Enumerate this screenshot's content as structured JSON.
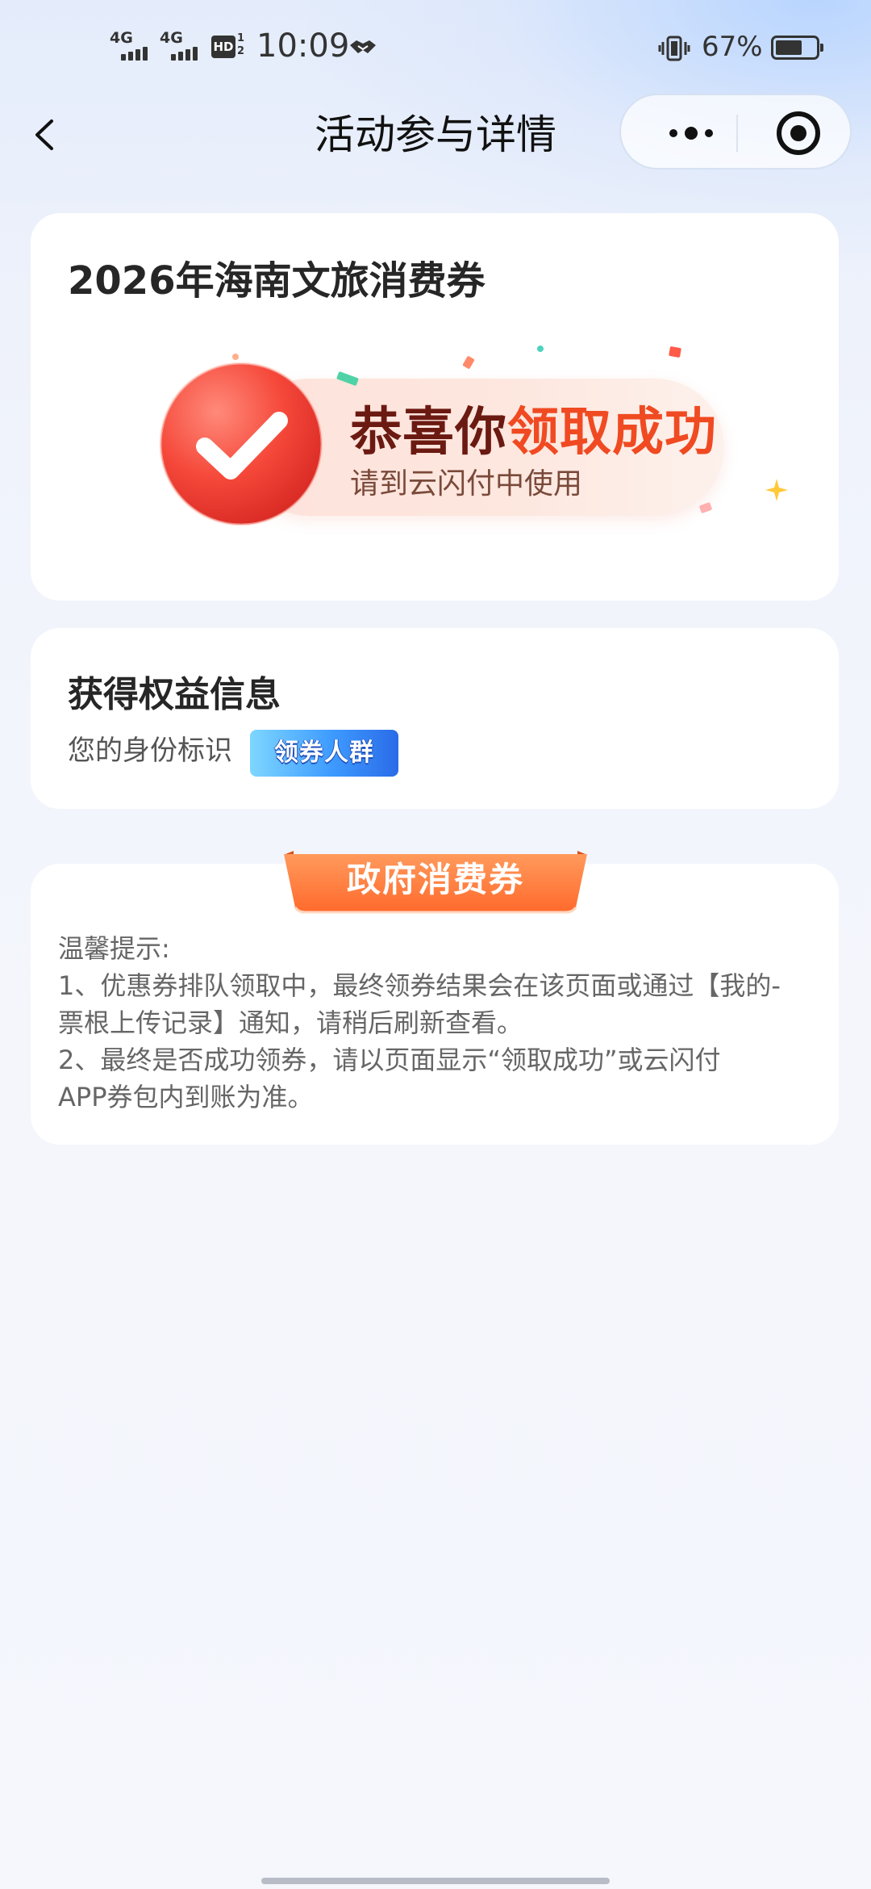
{
  "status_bar": {
    "network_1": "4G",
    "network_2": "4G",
    "hd_label": "HD",
    "hd_sub": "1\n2",
    "time": "10:09",
    "battery_percent": "67%",
    "battery_level": 0.67
  },
  "nav": {
    "title": "活动参与详情"
  },
  "activity": {
    "title": "2026年海南文旅消费券",
    "banner_line1_dark": "恭喜你",
    "banner_line1_highlight": "领取成功",
    "banner_line2": "请到云闪付中使用"
  },
  "rights": {
    "title": "获得权益信息",
    "identity_label": "您的身份标识",
    "identity_badge": "领券人群"
  },
  "gov_coupon": {
    "ribbon": "政府消费券",
    "tips": [
      "温馨提示:",
      "1、优惠券排队领取中，最终领券结果会在该页面或通过【我的-",
      "票根上传记录】通知，请稍后刷新查看。",
      "2、最终是否成功领券，请以页面显示“领取成功”或云闪付",
      "APP券包内到账为准。"
    ]
  },
  "colors": {
    "accent_red": "#f04a22",
    "badge_blue": "#3e9bff",
    "ribbon_orange": "#ff7a3c"
  }
}
